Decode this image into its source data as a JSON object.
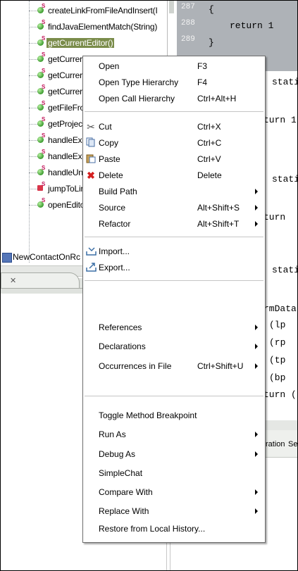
{
  "outline": {
    "items": [
      {
        "label": "createLinkFromFileAndInsert(I",
        "icon": "public-static-method-icon"
      },
      {
        "label": "findJavaElementMatch(String)",
        "icon": "public-static-method-icon"
      },
      {
        "label": "getCurrentEditor()",
        "icon": "public-static-method-icon",
        "selected": true
      },
      {
        "label": "getCurrer",
        "icon": "public-static-method-icon"
      },
      {
        "label": "getCurrer",
        "icon": "public-static-method-icon"
      },
      {
        "label": "getCurrer",
        "icon": "public-static-method-icon"
      },
      {
        "label": "getFileFro",
        "icon": "public-static-method-icon"
      },
      {
        "label": "getProjec",
        "icon": "public-static-method-icon"
      },
      {
        "label": "handleExc",
        "icon": "public-static-method-icon"
      },
      {
        "label": "handleExc",
        "icon": "public-static-method-icon"
      },
      {
        "label": "handleUn",
        "icon": "public-static-method-icon"
      },
      {
        "label": "jumpToLir",
        "icon": "private-static-method-icon"
      },
      {
        "label": "openEdito",
        "icon": "public-static-method-icon"
      }
    ],
    "compilation_unit": "NewContactOnRc"
  },
  "editor": {
    "line_numbers": [
      "287",
      "288",
      "289"
    ],
    "code_lines": [
      "{",
      "return 1",
      "}",
      "stati",
      "turn 1",
      "stati",
      "turn",
      "stati",
      "rmData",
      "(lp",
      "(rp",
      "(tp",
      "(bp",
      "turn ("
    ]
  },
  "lower_panel": {
    "tab_close": "✕",
    "tabs": [
      "ration",
      "Se"
    ]
  },
  "context_menu": {
    "items": [
      {
        "label": "Open",
        "accel": "F3"
      },
      {
        "label": "Open Type Hierarchy",
        "accel": "F4"
      },
      {
        "label": "Open Call Hierarchy",
        "accel": "Ctrl+Alt+H"
      },
      {
        "label": "Cut",
        "accel": "Ctrl+X",
        "icon": "scissors-icon"
      },
      {
        "label": "Copy",
        "accel": "Ctrl+C",
        "icon": "copy-icon"
      },
      {
        "label": "Paste",
        "accel": "Ctrl+V",
        "icon": "paste-icon"
      },
      {
        "label": "Delete",
        "accel": "Delete",
        "icon": "delete-icon"
      },
      {
        "label": "Build Path",
        "submenu": true
      },
      {
        "label": "Source",
        "accel": "Alt+Shift+S",
        "submenu": true
      },
      {
        "label": "Refactor",
        "accel": "Alt+Shift+T",
        "submenu": true
      },
      {
        "label": "Import...",
        "icon": "import-icon"
      },
      {
        "label": "Export...",
        "icon": "export-icon"
      },
      {
        "label": "References",
        "submenu": true
      },
      {
        "label": "Declarations",
        "submenu": true
      },
      {
        "label": "Occurrences in File",
        "accel": "Ctrl+Shift+U",
        "submenu": true
      },
      {
        "label": "Toggle Method Breakpoint"
      },
      {
        "label": "Run As",
        "submenu": true
      },
      {
        "label": "Debug As",
        "submenu": true
      },
      {
        "label": "SimpleChat"
      },
      {
        "label": "Compare With",
        "submenu": true
      },
      {
        "label": "Replace With",
        "submenu": true
      },
      {
        "label": "Restore from Local History..."
      }
    ]
  },
  "colors": {
    "editor_background": "#aeb2b7",
    "selection": "#7a8c4a",
    "method_icon": "#3d9b2f",
    "delete_icon": "#d42020"
  }
}
